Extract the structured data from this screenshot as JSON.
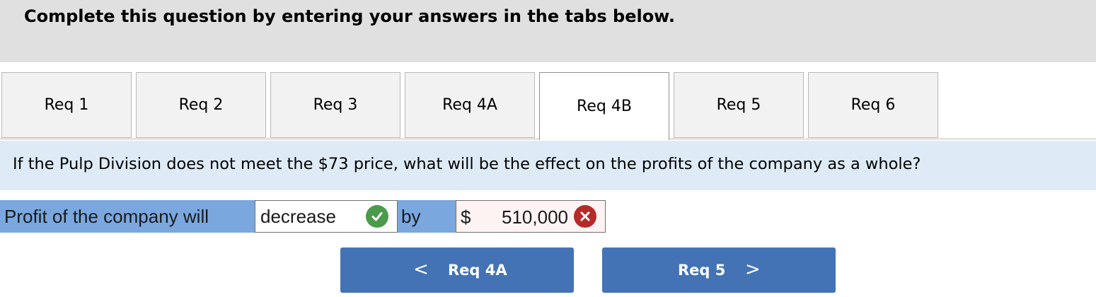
{
  "header": {
    "title": "Complete this question by entering your answers in the tabs below."
  },
  "tabs": [
    {
      "label": "Req 1"
    },
    {
      "label": "Req 2"
    },
    {
      "label": "Req 3"
    },
    {
      "label": "Req 4A"
    },
    {
      "label": "Req 4B",
      "active": true
    },
    {
      "label": "Req 5"
    },
    {
      "label": "Req 6"
    }
  ],
  "question": {
    "text": "If the Pulp Division does not meet the $73 price, what will be the effect on the profits of the company as a whole?"
  },
  "answer": {
    "label": "Profit of the company will",
    "selected_value": "decrease",
    "selected_status": "correct",
    "by_label": "by",
    "currency_symbol": "$",
    "amount_value": "510,000",
    "amount_status": "incorrect"
  },
  "navigation": {
    "prev_label": "Req 4A",
    "next_label": "Req 5",
    "prev_chevron": "<",
    "next_chevron": ">"
  },
  "colors": {
    "header_bg": "#e0e0e0",
    "question_bg": "#deebf6",
    "label_cell_bg": "#7aa8de",
    "correct": "#4c9a4c",
    "incorrect": "#b72a2a",
    "button_bg": "#4373b4"
  }
}
